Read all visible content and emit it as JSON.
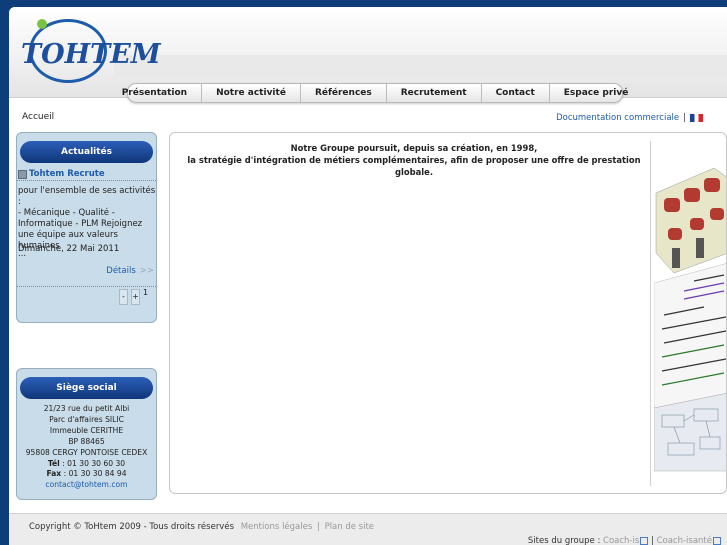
{
  "brand": {
    "logo_text": "TOHTEM"
  },
  "nav": {
    "items": [
      "Présentation",
      "Notre activité",
      "Références",
      "Recrutement",
      "Contact",
      "Espace privé"
    ]
  },
  "breadcrumb": "Accueil",
  "toplinks": {
    "doc_link": "Documentation commerciale",
    "sep": "|"
  },
  "news": {
    "header": "Actualités",
    "title": "Tohtem Recrute",
    "body_lines": [
      "pour l'ensemble de ses activités :",
      "- Mécanique - Qualité -",
      "Informatique - PLM   Rejoignez",
      "une équipe aux valeurs humaines",
      "..."
    ],
    "date": "Dimanche, 22 Mai 2011",
    "details": "Détails",
    "details_arrow": ">>",
    "pager": {
      "minus": "-",
      "plus": "+",
      "page": "1"
    }
  },
  "siege": {
    "header": "Siège social",
    "lines": [
      "21/23 rue du petit Albi",
      "Parc d'affaires SILIC",
      "Immeuble CERITHE",
      "BP 88465",
      "95808 CERGY PONTOISE CEDEX"
    ],
    "tel_label": "Tél",
    "tel": " : 01 30 30 60 30",
    "fax_label": "Fax",
    "fax": " : 01 30 30 84 94",
    "email": "contact@tohtem.com"
  },
  "main": {
    "intro_line1": "Notre Groupe poursuit, depuis sa création, en 1998,",
    "intro_line2": "la stratégie d'intégration de métiers complémentaires, afin de proposer une offre de prestation globale."
  },
  "footer": {
    "copyright": "Copyright © ToHtem 2009 - Tous droits réservés",
    "legal": "Mentions légales",
    "sitemap": "Plan de site",
    "group_label": "Sites du groupe :",
    "site1": "Coach-is",
    "site2": "Coach-isanté"
  },
  "colors": {
    "brand_blue": "#1d5bab",
    "page_bg": "#0d3e7a",
    "panel_bg": "#c9dce9"
  }
}
